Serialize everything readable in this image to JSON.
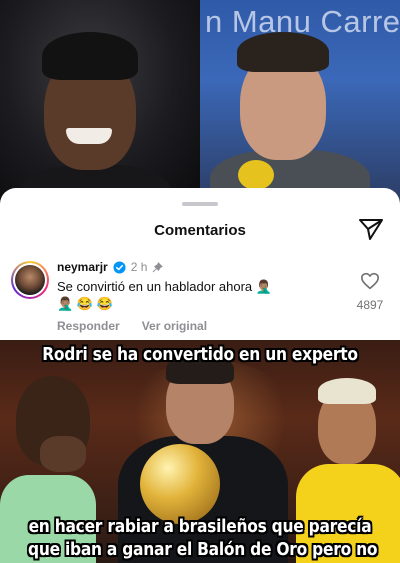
{
  "top_photo": {
    "screen_text": "n Manu Carre"
  },
  "comments_sheet": {
    "title": "Comentarios",
    "comment": {
      "username": "neymarjr",
      "time": "2 h",
      "line1": "Se convirtió en un hablador ahora 🤦🏽‍♂️",
      "line2": "🤦🏽‍♂️ 😂 😂",
      "likes": "4897",
      "reply_label": "Responder",
      "see_original_label": "Ver original"
    },
    "icons": {
      "send": "paper-plane-icon",
      "verified": "verified-badge-icon",
      "pinned": "pin-icon",
      "like": "heart-icon"
    },
    "colors": {
      "verified": "#0095f6",
      "muted": "#8e8e93"
    }
  },
  "meme": {
    "top_text": "Rodri se ha convertido en un experto",
    "bottom_text_line1": "en hacer rabiar a brasileños que parecía",
    "bottom_text_line2": "que iban a ganar el Balón de Oro pero no"
  }
}
